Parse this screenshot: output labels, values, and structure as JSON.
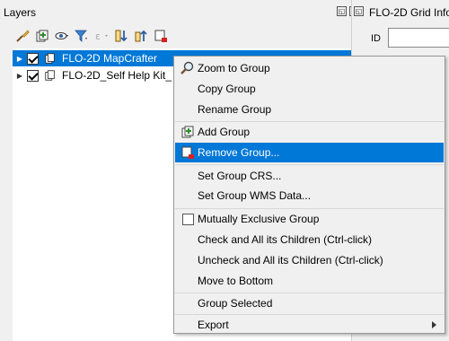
{
  "layers_panel": {
    "title": "Layers",
    "controls": [
      "float",
      "close"
    ],
    "toolbar_icons": [
      "style-manager-icon",
      "add-group-icon",
      "manage-visibility-icon",
      "filter-legend-icon",
      "filter-expression-icon",
      "expand-all-icon",
      "collapse-all-icon",
      "remove-layer-icon"
    ],
    "tree": [
      {
        "label": "FLO-2D MapCrafter",
        "checked": true,
        "selected": true
      },
      {
        "label": "FLO-2D_Self Help Kit_",
        "checked": true,
        "selected": false
      }
    ]
  },
  "grid_panel": {
    "title": "FLO-2D Grid Info",
    "id_label": "ID",
    "id_value": ""
  },
  "context_menu": {
    "items": [
      {
        "label": "Zoom to Group",
        "icon": "zoom-icon"
      },
      {
        "label": "Copy Group"
      },
      {
        "label": "Rename Group"
      },
      {
        "separator": true
      },
      {
        "label": "Add Group",
        "icon": "add-group-icon"
      },
      {
        "label": "Remove Group...",
        "icon": "remove-group-icon",
        "highlighted": true
      },
      {
        "separator": true
      },
      {
        "label": "Set Group CRS..."
      },
      {
        "label": "Set Group WMS Data..."
      },
      {
        "separator": true
      },
      {
        "label": "Mutually Exclusive Group",
        "checkbox": true
      },
      {
        "label": "Check and All its Children (Ctrl-click)"
      },
      {
        "label": "Uncheck and All its Children (Ctrl-click)"
      },
      {
        "label": "Move to Bottom"
      },
      {
        "separator": true
      },
      {
        "label": "Group Selected"
      },
      {
        "separator": true
      },
      {
        "label": "Export",
        "submenu": true
      }
    ]
  },
  "colors": {
    "selection": "#0078d7",
    "background": "#f0f0f0",
    "tree_bg": "#ffffff"
  }
}
